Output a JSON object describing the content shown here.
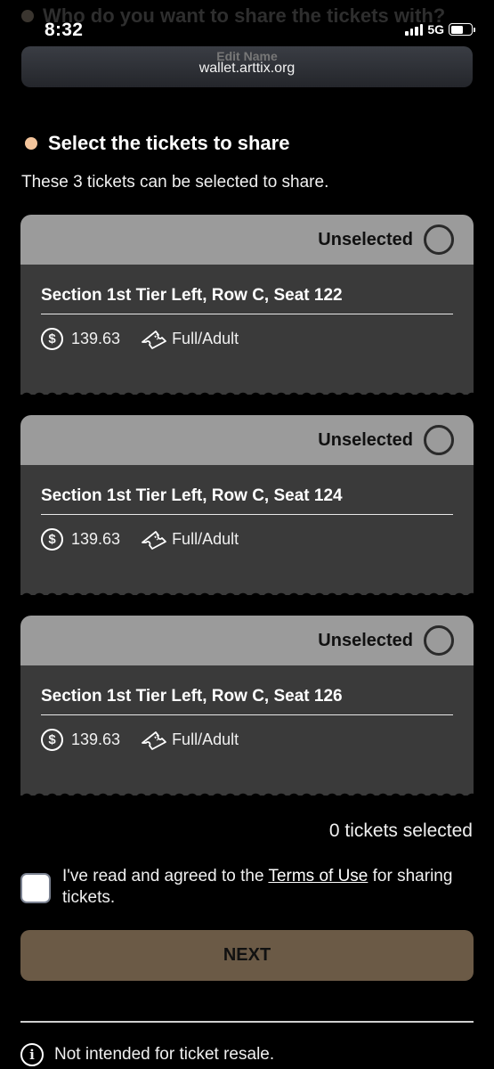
{
  "status_bar": {
    "time": "8:32",
    "network": "5G",
    "icons": [
      "signal-icon",
      "battery-icon"
    ]
  },
  "browser": {
    "url": "wallet.arttix.org"
  },
  "behind": {
    "heading": "Who do you want to share the tickets with?",
    "button": "Edit Name"
  },
  "section": {
    "title": "Select the tickets to share",
    "subtitle": "These 3 tickets can be selected to share.",
    "bullet_color": "#f3c49b"
  },
  "tickets": [
    {
      "status": "Unselected",
      "seat": "Section 1st Tier Left, Row C, Seat 122",
      "price": "139.63",
      "type": "Full/Adult"
    },
    {
      "status": "Unselected",
      "seat": "Section 1st Tier Left, Row C, Seat 124",
      "price": "139.63",
      "type": "Full/Adult"
    },
    {
      "status": "Unselected",
      "seat": "Section 1st Tier Left, Row C, Seat 126",
      "price": "139.63",
      "type": "Full/Adult"
    }
  ],
  "selection": {
    "count_text": "0 tickets selected"
  },
  "agreement": {
    "prefix": "I've read and agreed to the ",
    "link": "Terms of Use",
    "suffix": " for sharing tickets.",
    "checked": false
  },
  "next_button": {
    "label": "NEXT",
    "color": "#6b5a46"
  },
  "footnote": {
    "text": "Not intended for ticket resale."
  }
}
